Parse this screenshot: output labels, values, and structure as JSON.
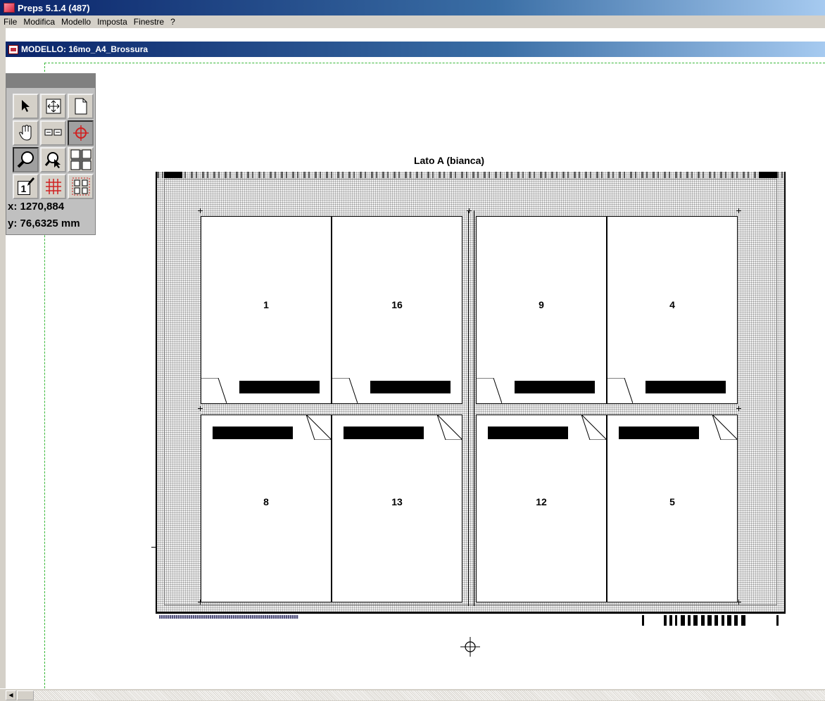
{
  "app": {
    "title": "Preps 5.1.4 (487)"
  },
  "menu": {
    "items": [
      "File",
      "Modifica",
      "Modello",
      "Imposta",
      "Finestre",
      "?"
    ]
  },
  "document": {
    "title": "MODELLO: 16mo_A4_Brossura"
  },
  "sheet": {
    "title": "Lato A (bianca)",
    "top_row": [
      "1",
      "16",
      "9",
      "4"
    ],
    "bottom_row": [
      "8",
      "13",
      "12",
      "5"
    ]
  },
  "palette": {
    "tools": [
      "arrow-tool",
      "move-tool",
      "page-tool",
      "hand-tool",
      "mark-tool",
      "crosshair-tool",
      "zoom-in-tool",
      "zoom-out-tool",
      "gutter-tool",
      "page-number-tool",
      "grid-tool",
      "layout-tool"
    ],
    "page_number_tool_label": "1",
    "x_readout": "x: 1270,884",
    "y_readout": "y: 76,6325 mm"
  },
  "colors": {
    "titlebar": "#0a246a",
    "chrome": "#d4d0c8",
    "guide": "#38b838",
    "crosshair": "#d02020"
  }
}
